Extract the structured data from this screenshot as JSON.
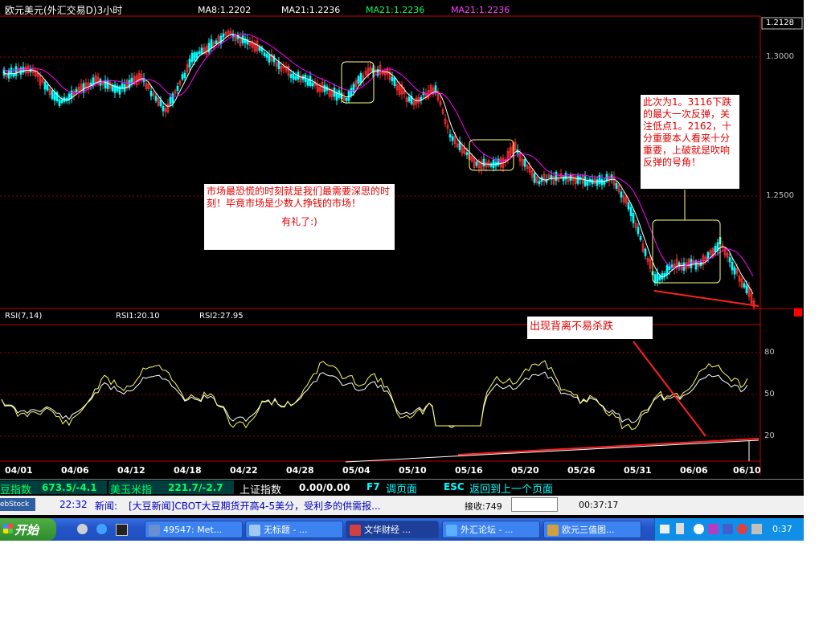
{
  "chart_header": {
    "title": "欧元美元(外汇交易D)3小时",
    "ma8": "MA8:1.2202",
    "ma21a": "MA21:1.2236",
    "ma21b": "MA21:1.2236",
    "ma21c": "MA21:1.2236"
  },
  "price_axis": [
    "1.2128",
    "1.3000",
    "1.2500"
  ],
  "rsi_header": {
    "name": "RSI(7,14)",
    "rsi1": "RSI1:20.10",
    "rsi2": "RSI2:27.95"
  },
  "rsi_axis": [
    "80",
    "50",
    "20"
  ],
  "dates": [
    "04/01",
    "04/06",
    "04/12",
    "04/18",
    "04/22",
    "04/28",
    "05/04",
    "05/10",
    "05/16",
    "05/20",
    "05/26",
    "05/31",
    "06/06",
    "06/10"
  ],
  "notes": {
    "panic_text": "市场最恐慌的时刻就是我们最需要深思的时刻！毕竟市场是少数人挣钱的市场！",
    "regards": "有礼了:)",
    "rebound_text": "此次为1。3116下跌的最大一次反弹，关注低点1。2162，十分重要本人看来十分重要，上破就是吹响反弹的号角！",
    "divergence": "出现背离不易杀跌"
  },
  "quote_bar": {
    "q1_name": "豆指数",
    "q1_val": "673.5/-4.1",
    "q2_name": "美玉米指",
    "q2_val": "221.7/-2.7",
    "q3_name": "上证指数",
    "q3_val": "0.00/0.00",
    "f7_key": "F7",
    "f7_label": "调页面",
    "esc_key": "ESC",
    "esc_label": "返回到上一个页面"
  },
  "news_bar": {
    "logo": "ebStock",
    "time": "22:32",
    "prefix": "新闻:",
    "headline": "[大豆新闻]CBOT大豆期货开高4-5美分，受利多的供需报...",
    "recv_label": "接收:749",
    "input_value": "",
    "clock": "00:37:17"
  },
  "taskbar": {
    "start": "开始",
    "buttons": [
      "49547: Met...",
      "无标题 - ...",
      "文华财经 ...",
      "外汇论坛 - ...",
      "欧元三值图..."
    ],
    "time": "0:37"
  },
  "colors": {
    "background": "#000000",
    "candle_up": "#ff3030",
    "candle_down": "#00ffff",
    "ma_white": "#ffffff",
    "ma_magenta": "#ff00ff",
    "ma_yellow": "#ffff60",
    "annotation_red": "#ff2020",
    "annotation_yellow": "#ffff80"
  }
}
